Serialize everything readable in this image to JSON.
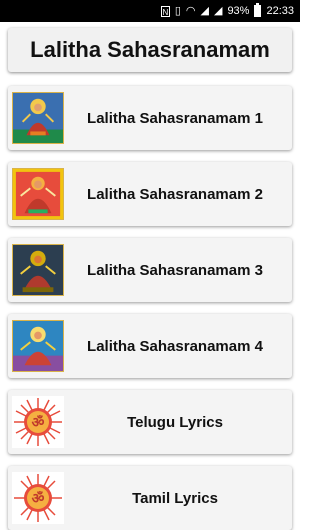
{
  "status_bar": {
    "battery": "93%",
    "time": "22:33",
    "icons": [
      "nfc-icon",
      "vibrate-icon",
      "wifi-icon",
      "signal-icon",
      "battery-icon"
    ]
  },
  "header": {
    "title": "Lalitha Sahasranamam"
  },
  "items": [
    {
      "label": "Lalitha Sahasranamam 1",
      "icon": "goddess-image-1"
    },
    {
      "label": "Lalitha Sahasranamam 2",
      "icon": "goddess-image-2"
    },
    {
      "label": "Lalitha Sahasranamam 3",
      "icon": "goddess-image-3"
    },
    {
      "label": "Lalitha Sahasranamam 4",
      "icon": "goddess-image-4"
    },
    {
      "label": "Telugu Lyrics",
      "icon": "om-icon"
    },
    {
      "label": "Tamil Lyrics",
      "icon": "om-icon"
    }
  ]
}
